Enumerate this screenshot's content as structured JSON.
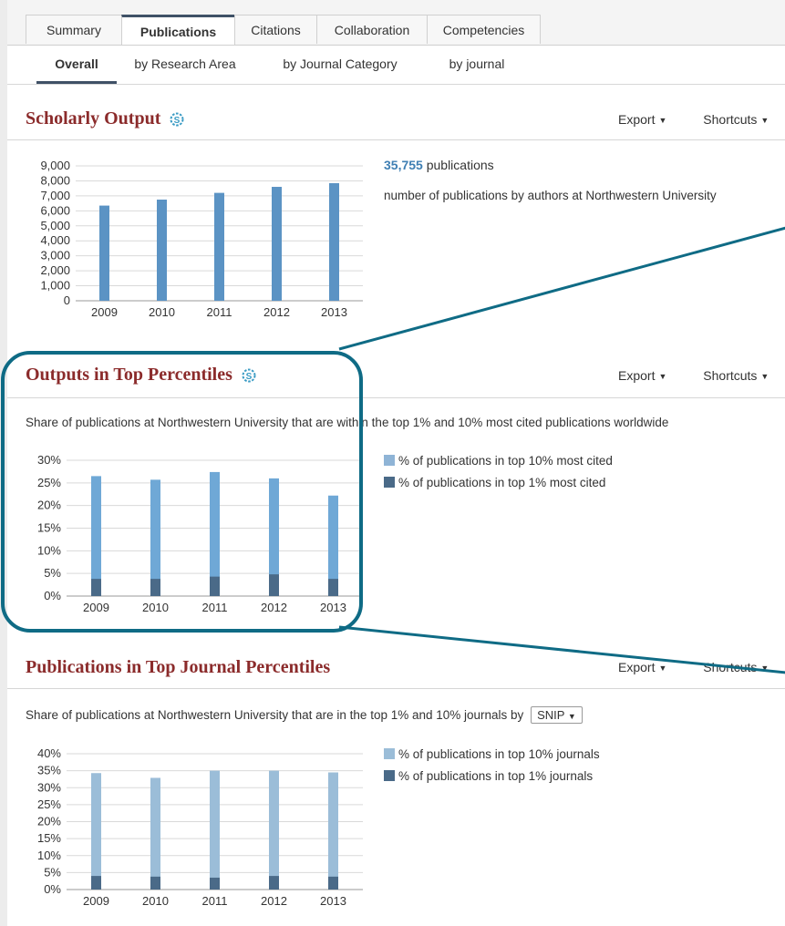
{
  "tabs": [
    "Summary",
    "Publications",
    "Citations",
    "Collaboration",
    "Competencies"
  ],
  "active_tab": "Publications",
  "subtabs": [
    "Overall",
    "by Research Area",
    "by Journal Category",
    "by journal"
  ],
  "active_subtab": "Overall",
  "actions": {
    "export": "Export",
    "shortcuts": "Shortcuts"
  },
  "scholarly": {
    "title": "Scholarly Output",
    "count": "35,755",
    "count_suffix": " publications",
    "description": "number of publications by authors at Northwestern University"
  },
  "top_percentiles": {
    "title": "Outputs in Top Percentiles",
    "description": "Share of publications at Northwestern University that are within the top 1% and 10% most cited publications worldwide",
    "legend": [
      "% of publications in top 10% most cited",
      "% of publications in top 1% most cited"
    ]
  },
  "journal_percentiles": {
    "title": "Publications in Top Journal Percentiles",
    "description": "Share of publications at Northwestern University that are in the top 1% and 10% journals by",
    "select_value": "SNIP",
    "legend": [
      "% of publications in top 10% journals",
      "% of publications in top 1% journals"
    ]
  },
  "colors": {
    "title": "#8b2b2b",
    "bar_medium": "#5b93c4",
    "bar_light": "#6fa8d6",
    "bar_pale": "#9bbdd8",
    "bar_dark": "#4a6a88",
    "highlight": "#0f6b85",
    "tab_accent": "#3f5166"
  },
  "chart_data": [
    {
      "type": "bar",
      "categories": [
        "2009",
        "2010",
        "2011",
        "2012",
        "2013"
      ],
      "values": [
        6350,
        6750,
        7200,
        7600,
        7850
      ],
      "ylim": [
        0,
        9000
      ],
      "yticks": [
        "0",
        "1,000",
        "2,000",
        "3,000",
        "4,000",
        "5,000",
        "6,000",
        "7,000",
        "8,000",
        "9,000"
      ],
      "xlabel": "",
      "ylabel": "",
      "grid": true
    },
    {
      "type": "bar",
      "categories": [
        "2009",
        "2010",
        "2011",
        "2012",
        "2013"
      ],
      "series": [
        {
          "name": "% of publications in top 10% most cited",
          "values": [
            26.5,
            25.7,
            27.4,
            26.0,
            22.2
          ]
        },
        {
          "name": "% of publications in top 1% most cited",
          "values": [
            3.8,
            3.8,
            4.3,
            4.8,
            3.8
          ]
        }
      ],
      "ylim": [
        0,
        30
      ],
      "yticks": [
        "0%",
        "5%",
        "10%",
        "15%",
        "20%",
        "25%",
        "30%"
      ],
      "legend_position": "right",
      "grid": true
    },
    {
      "type": "bar",
      "categories": [
        "2009",
        "2010",
        "2011",
        "2012",
        "2013"
      ],
      "series": [
        {
          "name": "% of publications in top 10% journals",
          "values": [
            34.3,
            32.9,
            35.0,
            35.0,
            34.5
          ]
        },
        {
          "name": "% of publications in top 1% journals",
          "values": [
            4.0,
            3.8,
            3.5,
            4.0,
            3.8
          ]
        }
      ],
      "ylim": [
        0,
        40
      ],
      "yticks": [
        "0%",
        "5%",
        "10%",
        "15%",
        "20%",
        "25%",
        "30%",
        "35%",
        "40%"
      ],
      "legend_position": "right",
      "grid": true
    }
  ]
}
